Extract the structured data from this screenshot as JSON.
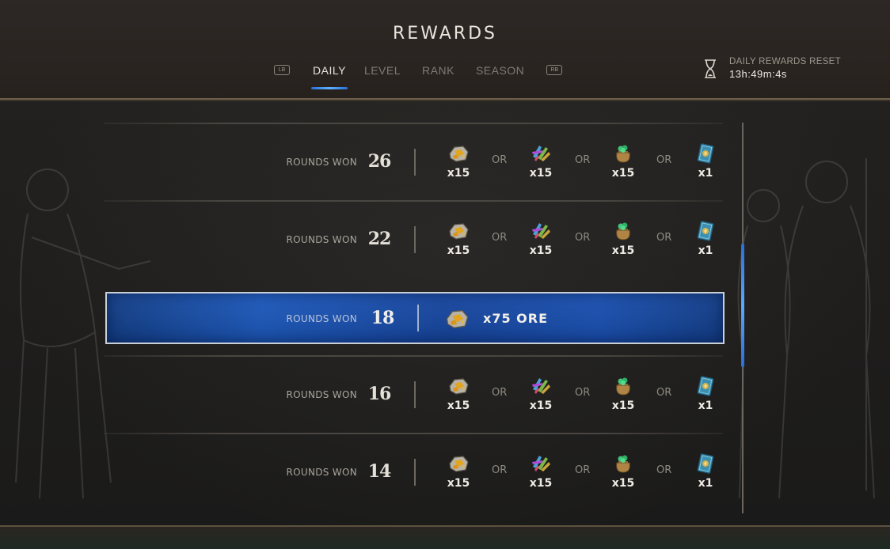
{
  "header": {
    "title": "REWARDS",
    "lb_hint": "LB",
    "rb_hint": "RB",
    "tabs": [
      {
        "label": "DAILY",
        "active": true
      },
      {
        "label": "LEVEL",
        "active": false
      },
      {
        "label": "RANK",
        "active": false
      },
      {
        "label": "SEASON",
        "active": false
      }
    ],
    "reset": {
      "label": "DAILY REWARDS RESET",
      "time": "13h:49m:4s",
      "icon": "hourglass-icon"
    }
  },
  "colors": {
    "accent": "#2a6fd6",
    "highlight_row": "#1e5bbf",
    "gold_border": "#6e5f4a"
  },
  "rows": [
    {
      "label": "ROUNDS WON",
      "rounds": "26",
      "highlight": false,
      "rewards": [
        {
          "icon": "ore-icon",
          "qty": "x15"
        },
        {
          "icon": "scraps-icon",
          "qty": "x15"
        },
        {
          "icon": "powder-sack-icon",
          "qty": "x15"
        },
        {
          "icon": "keg-card-icon",
          "qty": "x1"
        }
      ],
      "or_text": "OR"
    },
    {
      "label": "ROUNDS WON",
      "rounds": "22",
      "highlight": false,
      "rewards": [
        {
          "icon": "ore-icon",
          "qty": "x15"
        },
        {
          "icon": "scraps-icon",
          "qty": "x15"
        },
        {
          "icon": "powder-sack-icon",
          "qty": "x15"
        },
        {
          "icon": "keg-card-icon",
          "qty": "x1"
        }
      ],
      "or_text": "OR"
    },
    {
      "label": "ROUNDS WON",
      "rounds": "18",
      "highlight": true,
      "single_reward": {
        "icon": "ore-icon",
        "text": "x75 ORE"
      }
    },
    {
      "label": "ROUNDS WON",
      "rounds": "16",
      "highlight": false,
      "rewards": [
        {
          "icon": "ore-icon",
          "qty": "x15"
        },
        {
          "icon": "scraps-icon",
          "qty": "x15"
        },
        {
          "icon": "powder-sack-icon",
          "qty": "x15"
        },
        {
          "icon": "keg-card-icon",
          "qty": "x1"
        }
      ],
      "or_text": "OR"
    },
    {
      "label": "ROUNDS WON",
      "rounds": "14",
      "highlight": false,
      "rewards": [
        {
          "icon": "ore-icon",
          "qty": "x15"
        },
        {
          "icon": "scraps-icon",
          "qty": "x15"
        },
        {
          "icon": "powder-sack-icon",
          "qty": "x15"
        },
        {
          "icon": "keg-card-icon",
          "qty": "x1"
        }
      ],
      "or_text": "OR"
    }
  ]
}
